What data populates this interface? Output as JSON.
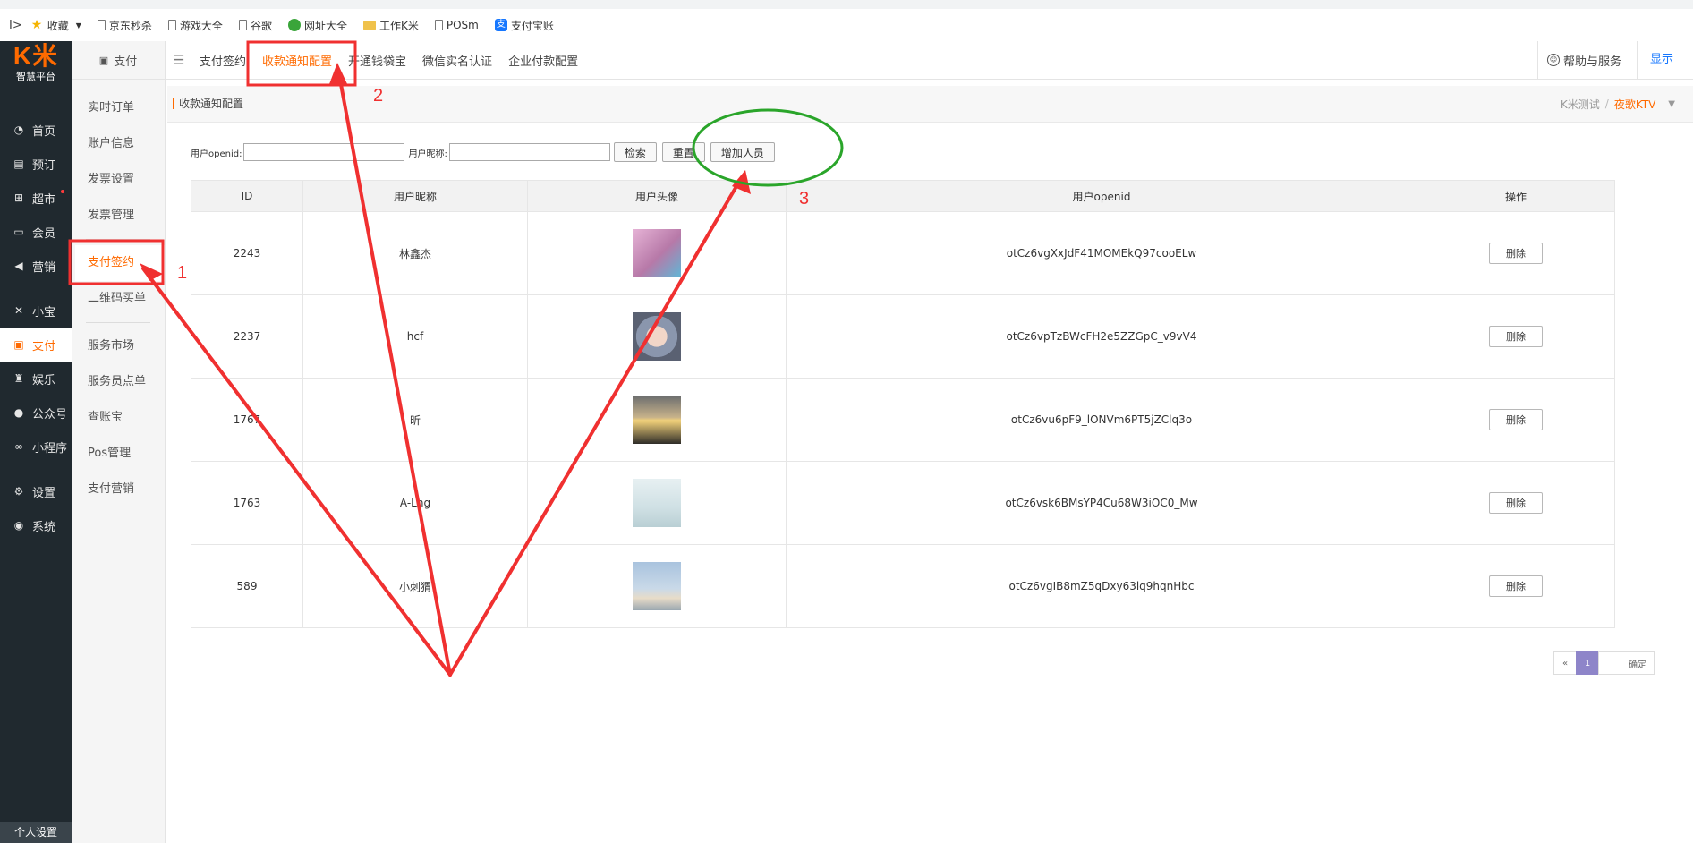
{
  "bookmarks": [
    {
      "label": "收藏",
      "icon": "star-icon"
    },
    {
      "label": "京东秒杀",
      "icon": "page-icon"
    },
    {
      "label": "游戏大全",
      "icon": "page-icon"
    },
    {
      "label": "谷歌",
      "icon": "page-icon"
    },
    {
      "label": "网址大全",
      "icon": "globe-icon"
    },
    {
      "label": "工作K米",
      "icon": "folder-icon"
    },
    {
      "label": "POSm",
      "icon": "page-icon"
    },
    {
      "label": "支付宝账",
      "icon": "alipay-icon"
    }
  ],
  "nav": {
    "logo_mark": "K米",
    "logo_sub": "智慧平台",
    "items": [
      {
        "label": "首页",
        "icon": "dashboard-icon"
      },
      {
        "label": "预订",
        "icon": "reserve-icon"
      },
      {
        "label": "超市",
        "icon": "basket-icon"
      },
      {
        "label": "会员",
        "icon": "card-icon"
      },
      {
        "label": "营销",
        "icon": "megaphone-icon"
      },
      {
        "label": "小宝",
        "icon": "xiaobao-icon"
      },
      {
        "label": "支付",
        "icon": "pay-icon"
      },
      {
        "label": "娱乐",
        "icon": "entertainment-icon"
      },
      {
        "label": "公众号",
        "icon": "wechat-icon"
      },
      {
        "label": "小程序",
        "icon": "miniprogram-icon"
      },
      {
        "label": "设置",
        "icon": "settings-icon"
      },
      {
        "label": "系统",
        "icon": "system-icon"
      }
    ],
    "bottom_label": "个人设置"
  },
  "subnav": {
    "head": "支付",
    "items": [
      "实时订单",
      "账户信息",
      "发票设置",
      "发票管理",
      "支付签约",
      "二维码买单",
      "服务市场",
      "服务员点单",
      "查账宝",
      "Pos管理",
      "支付营销"
    ]
  },
  "topbar": {
    "tabs": [
      "支付签约",
      "收款通知配置",
      "开通钱袋宝",
      "微信实名认证",
      "企业付款配置"
    ],
    "help": "帮助与服务",
    "show": "显示"
  },
  "titlebar": {
    "title": "收款通知配置",
    "crumb1": "K米测试",
    "crumb_sep": "/",
    "crumb2": "夜歌KTV"
  },
  "search": {
    "openid_label": "用户openid:",
    "nick_label": "用户昵称:",
    "search_btn": "检索",
    "reset_btn": "重置",
    "add_btn": "增加人员"
  },
  "table": {
    "headers": [
      "ID",
      "用户昵称",
      "用户头像",
      "用户openid",
      "操作"
    ],
    "rows": [
      {
        "id": "2243",
        "nick": "林鑫杰",
        "openid": "otCz6vgXxJdF41MOMEkQ97cooELw",
        "action": "删除",
        "avatar": "#d29ac0"
      },
      {
        "id": "2237",
        "nick": "hcf",
        "openid": "otCz6vpTzBWcFH2e5ZZGpC_v9vV4",
        "action": "删除",
        "avatar": "#7d8aa0"
      },
      {
        "id": "1767",
        "nick": "昕",
        "openid": "otCz6vu6pF9_lONVm6PT5jZClq3o",
        "action": "删除",
        "avatar": "#4d4a3e"
      },
      {
        "id": "1763",
        "nick": "  A-Lng  ",
        "openid": "otCz6vsk6BMsYP4Cu68W3iOC0_Mw",
        "action": "删除",
        "avatar": "#cfe2e6"
      },
      {
        "id": "589",
        "nick": "小刺猬",
        "openid": "otCz6vgIB8mZ5qDxy63lq9hqnHbc",
        "action": "删除",
        "avatar": "#9fb6cf"
      }
    ]
  },
  "pager": {
    "prev": "«",
    "current": "1",
    "go": "确定"
  },
  "annotations": {
    "n1": "1",
    "n2": "2",
    "n3": "3",
    "arrow_color": "#f03030",
    "circle_color": "#2aa52a"
  }
}
